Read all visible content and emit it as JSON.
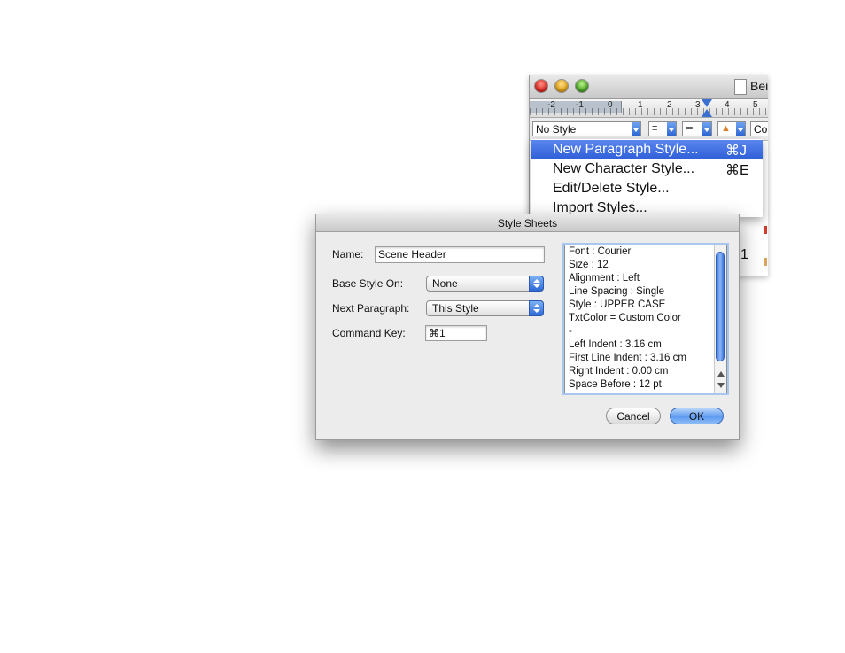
{
  "app_window": {
    "title": "Bei",
    "ruler_numbers": [
      "-2",
      "-1",
      "0",
      "1",
      "2",
      "3",
      "4",
      "5"
    ],
    "style_select": "No Style",
    "font_box": "Cou",
    "doc_number": "1"
  },
  "menu": {
    "items": [
      {
        "label": "New Paragraph Style...",
        "shortcut": "⌘J",
        "selected": true
      },
      {
        "label": "New Character Style...",
        "shortcut": "⌘E",
        "selected": false
      },
      {
        "label": "Edit/Delete Style...",
        "shortcut": "",
        "selected": false
      },
      {
        "label": "Import Styles...",
        "shortcut": "",
        "selected": false
      }
    ]
  },
  "dialog": {
    "title": "Style Sheets",
    "name_label": "Name:",
    "name_value": "Scene Header",
    "base_label": "Base Style On:",
    "base_value": "None",
    "next_label": "Next Paragraph:",
    "next_value": "This Style",
    "cmd_label": "Command Key:",
    "cmd_value": "⌘1",
    "info_lines": [
      "Font : Courier",
      "Size : 12",
      "Alignment : Left",
      "Line Spacing : Single",
      "Style : UPPER CASE",
      "TxtColor = Custom Color",
      "-",
      "Left Indent : 3.16 cm",
      "First Line Indent : 3.16 cm",
      "Right Indent : 0.00 cm",
      "Space Before : 12 pt"
    ],
    "cancel_label": "Cancel",
    "ok_label": "OK"
  }
}
